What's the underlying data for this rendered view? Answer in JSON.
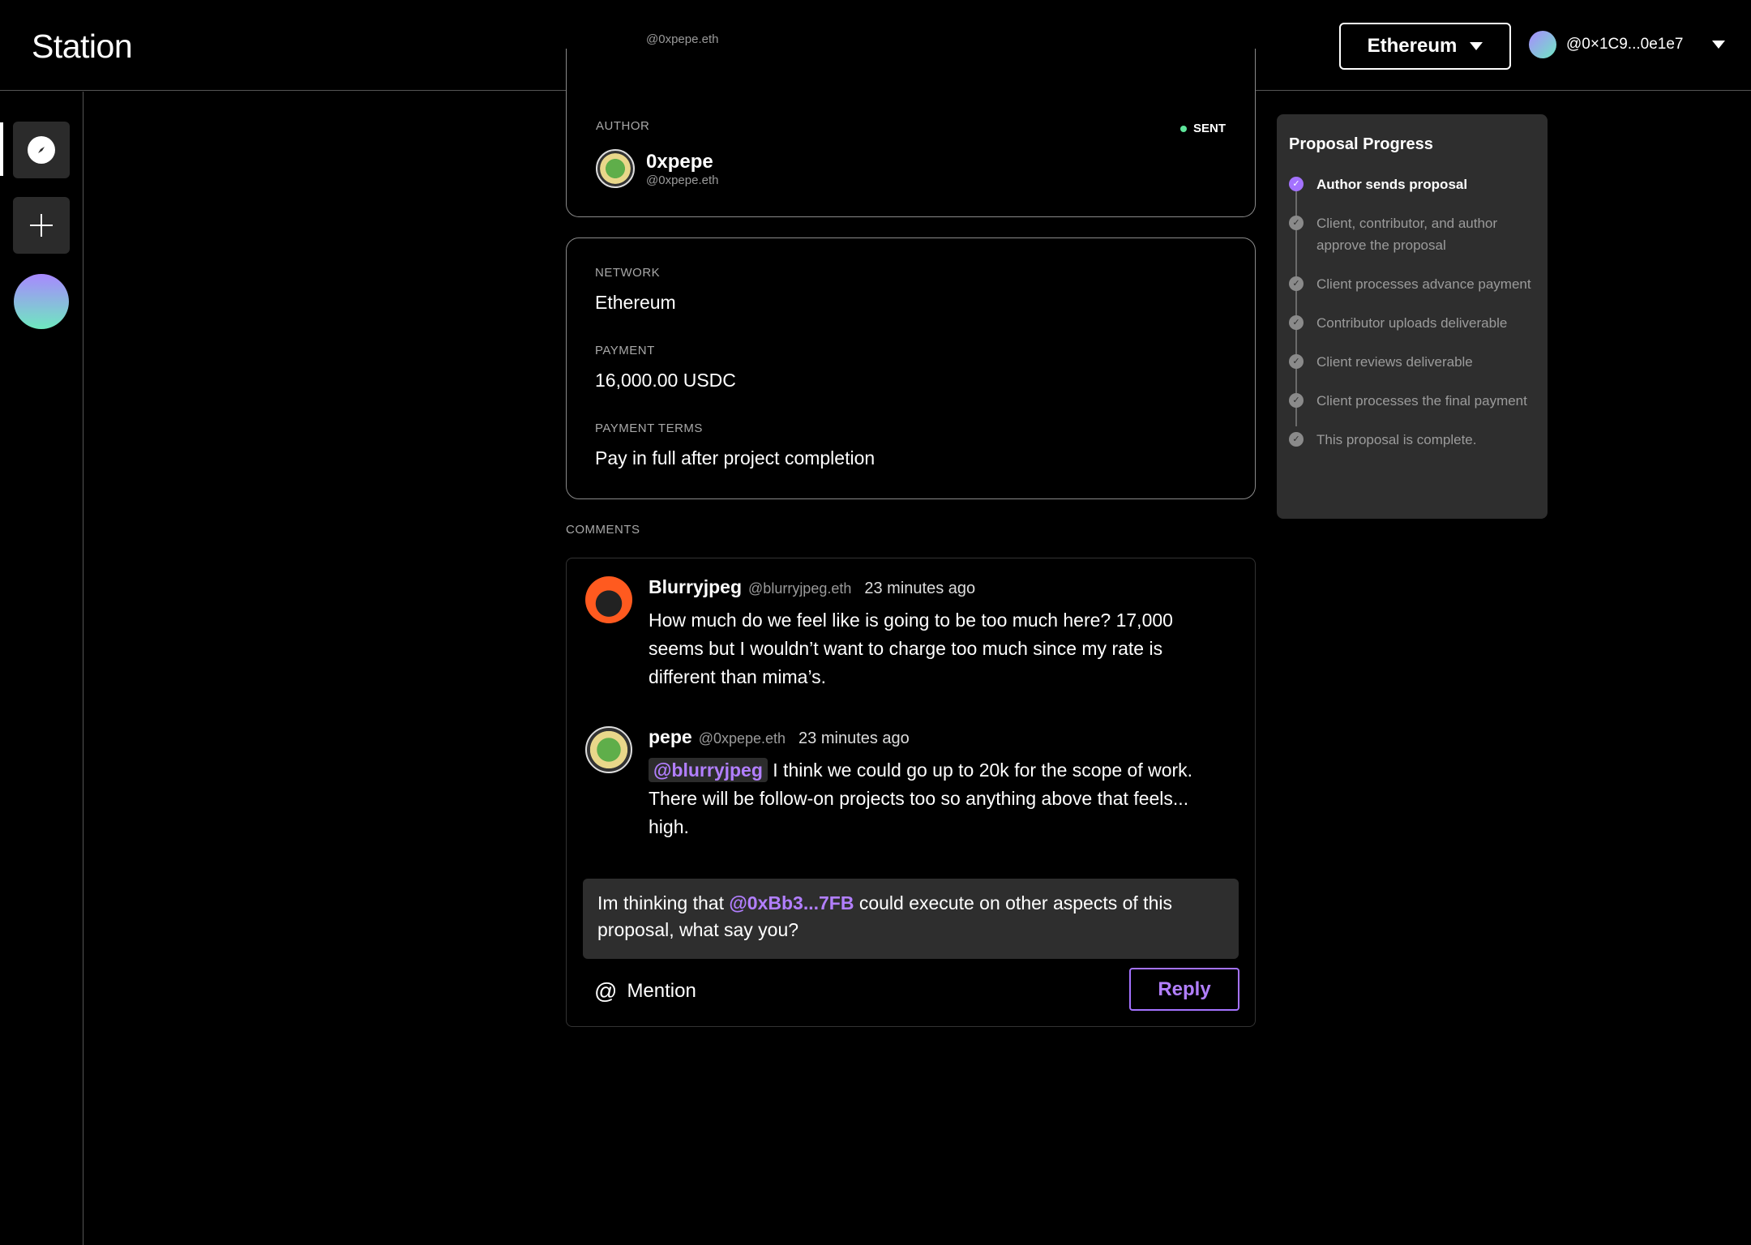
{
  "app": {
    "title": "Station"
  },
  "header": {
    "network_label": "Ethereum",
    "account_label": "@0×1C9...0e1e7"
  },
  "author_card": {
    "top_handle": "@0xpepe.eth",
    "label": "AUTHOR",
    "name": "0xpepe",
    "handle": "@0xpepe.eth",
    "status": "SENT"
  },
  "details": {
    "network_label": "NETWORK",
    "network_value": "Ethereum",
    "payment_label": "PAYMENT",
    "payment_value": "16,000.00 USDC",
    "terms_label": "PAYMENT TERMS",
    "terms_value": "Pay in full after project completion"
  },
  "comments": {
    "label": "COMMENTS",
    "items": [
      {
        "name": "Blurryjpeg",
        "handle": "@blurryjpeg.eth",
        "time": "23 minutes ago",
        "body": "How much do we feel like is going to be too much here? 17,000 seems but I wouldn’t want to charge too much since my rate is different than mima’s."
      },
      {
        "name": "pepe",
        "handle": "@0xpepe.eth",
        "time": "23 minutes ago",
        "mention": "@blurryjpeg",
        "body": " I think we could go up to 20k for the scope of work. There will be follow-on projects too so anything above that feels... high."
      }
    ],
    "composer": {
      "before": "Im thinking that ",
      "mention": "@0xBb3...7FB",
      "after": " could execute on other aspects of this  proposal, what say you?"
    },
    "mention_button": "Mention",
    "reply_button": "Reply"
  },
  "progress": {
    "title": "Proposal Progress",
    "steps": [
      "Author sends proposal",
      "Client, contributor, and author approve the proposal",
      "Client processes advance payment",
      "Contributor uploads deliverable",
      "Client reviews deliverable",
      "Client processes the final payment",
      "This proposal is complete."
    ],
    "active_index": 0
  },
  "icons": {
    "rail": [
      "compass-icon",
      "plus-icon"
    ],
    "status_dot_color": "#5ee69b",
    "accent": "#a472ff"
  }
}
